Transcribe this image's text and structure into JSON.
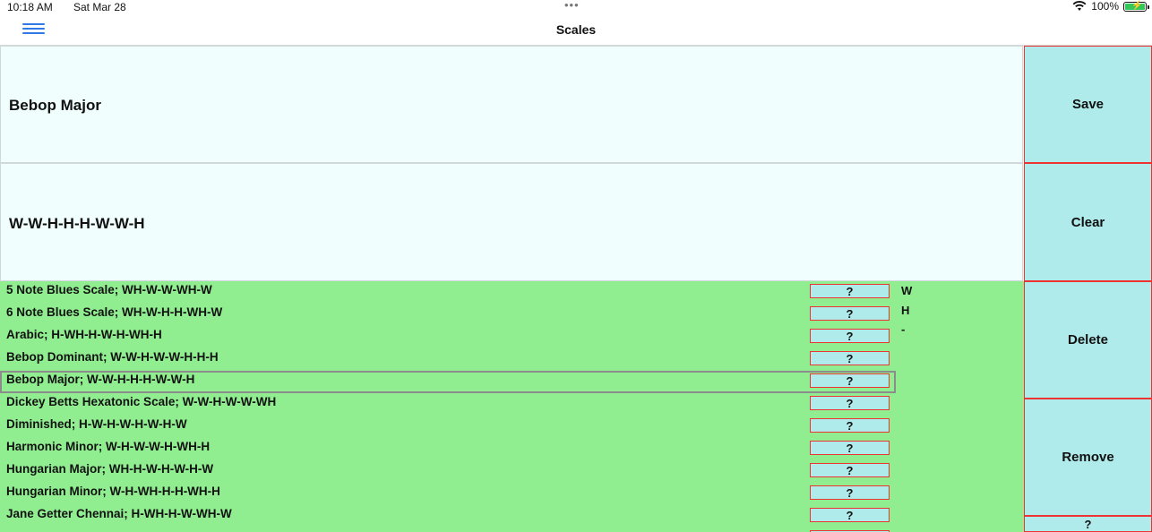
{
  "status_bar": {
    "time": "10:18 AM",
    "date": "Sat Mar 28",
    "battery": "100%",
    "icons": [
      "wifi-icon",
      "battery-charging-icon"
    ]
  },
  "nav": {
    "title": "Scales",
    "menu_icon": "hamburger-menu-icon",
    "accent": "#2f7be5"
  },
  "name_field": {
    "value": "Bebop Major"
  },
  "pattern_field": {
    "value": "W-W-H-H-H-W-W-H"
  },
  "buttons": {
    "save": "Save",
    "clear": "Clear",
    "delete": "Delete",
    "remove": "Remove",
    "help": "?"
  },
  "scales": [
    {
      "label": "5 Note Blues Scale; WH-W-W-WH-W",
      "help": "?"
    },
    {
      "label": "6 Note Blues Scale; WH-W-H-H-WH-W",
      "help": "?"
    },
    {
      "label": "Arabic; H-WH-H-W-H-WH-H",
      "help": "?"
    },
    {
      "label": "Bebop Dominant; W-W-H-W-W-H-H-H",
      "help": "?"
    },
    {
      "label": "Bebop Major; W-W-H-H-H-W-W-H",
      "help": "?",
      "selected": true
    },
    {
      "label": "Dickey Betts Hexatonic Scale; W-W-H-W-W-WH",
      "help": "?"
    },
    {
      "label": "Diminished; H-W-H-W-H-W-H-W",
      "help": "?"
    },
    {
      "label": "Harmonic Minor; W-H-W-W-H-WH-H",
      "help": "?"
    },
    {
      "label": "Hungarian Major; WH-H-W-H-W-H-W",
      "help": "?"
    },
    {
      "label": "Hungarian Minor; W-H-WH-H-H-WH-H",
      "help": "?"
    },
    {
      "label": "Jane Getter Chennai; H-WH-H-W-WH-W",
      "help": "?"
    }
  ],
  "legend": [
    "W",
    "H",
    "-"
  ],
  "colors": {
    "panel_bg": "#f0fefe",
    "list_bg": "#90ee90",
    "button_bg": "#afebeb",
    "button_border": "#ee3333",
    "selected_border": "#8c8c8c"
  }
}
